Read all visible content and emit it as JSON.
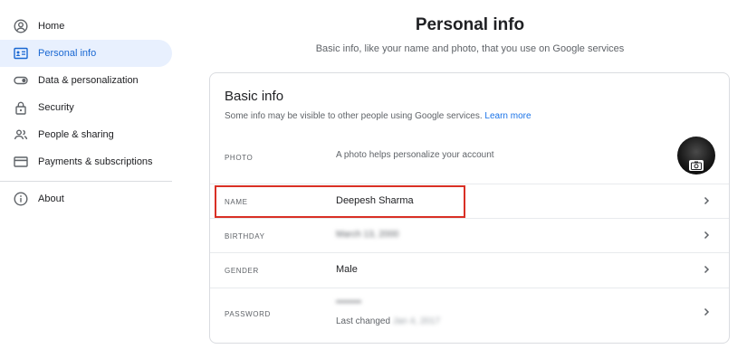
{
  "sidebar": {
    "items": [
      {
        "label": "Home",
        "icon": "account-circle-icon"
      },
      {
        "label": "Personal info",
        "icon": "id-card-icon",
        "active": true
      },
      {
        "label": "Data & personalization",
        "icon": "toggle-icon"
      },
      {
        "label": "Security",
        "icon": "lock-icon"
      },
      {
        "label": "People & sharing",
        "icon": "people-icon"
      },
      {
        "label": "Payments & subscriptions",
        "icon": "credit-card-icon"
      },
      {
        "label": "About",
        "icon": "info-icon"
      }
    ]
  },
  "header": {
    "title": "Personal info",
    "subtitle": "Basic info, like your name and photo, that you use on Google services"
  },
  "basic_info": {
    "title": "Basic info",
    "description": "Some info may be visible to other people using Google services.",
    "learn_more": "Learn more",
    "rows": {
      "photo": {
        "label": "PHOTO",
        "value": "A photo helps personalize your account"
      },
      "name": {
        "label": "NAME",
        "value": "Deepesh Sharma"
      },
      "birthday": {
        "label": "BIRTHDAY",
        "value": "March 13, 2000"
      },
      "gender": {
        "label": "GENDER",
        "value": "Male"
      },
      "password": {
        "label": "PASSWORD",
        "value": "••••••••",
        "last_changed_prefix": "Last changed",
        "last_changed_date": "Jan 4, 2017"
      }
    }
  },
  "colors": {
    "accent": "#1a73e8",
    "active_bg": "#e8f0fe",
    "highlight": "#d93025"
  }
}
